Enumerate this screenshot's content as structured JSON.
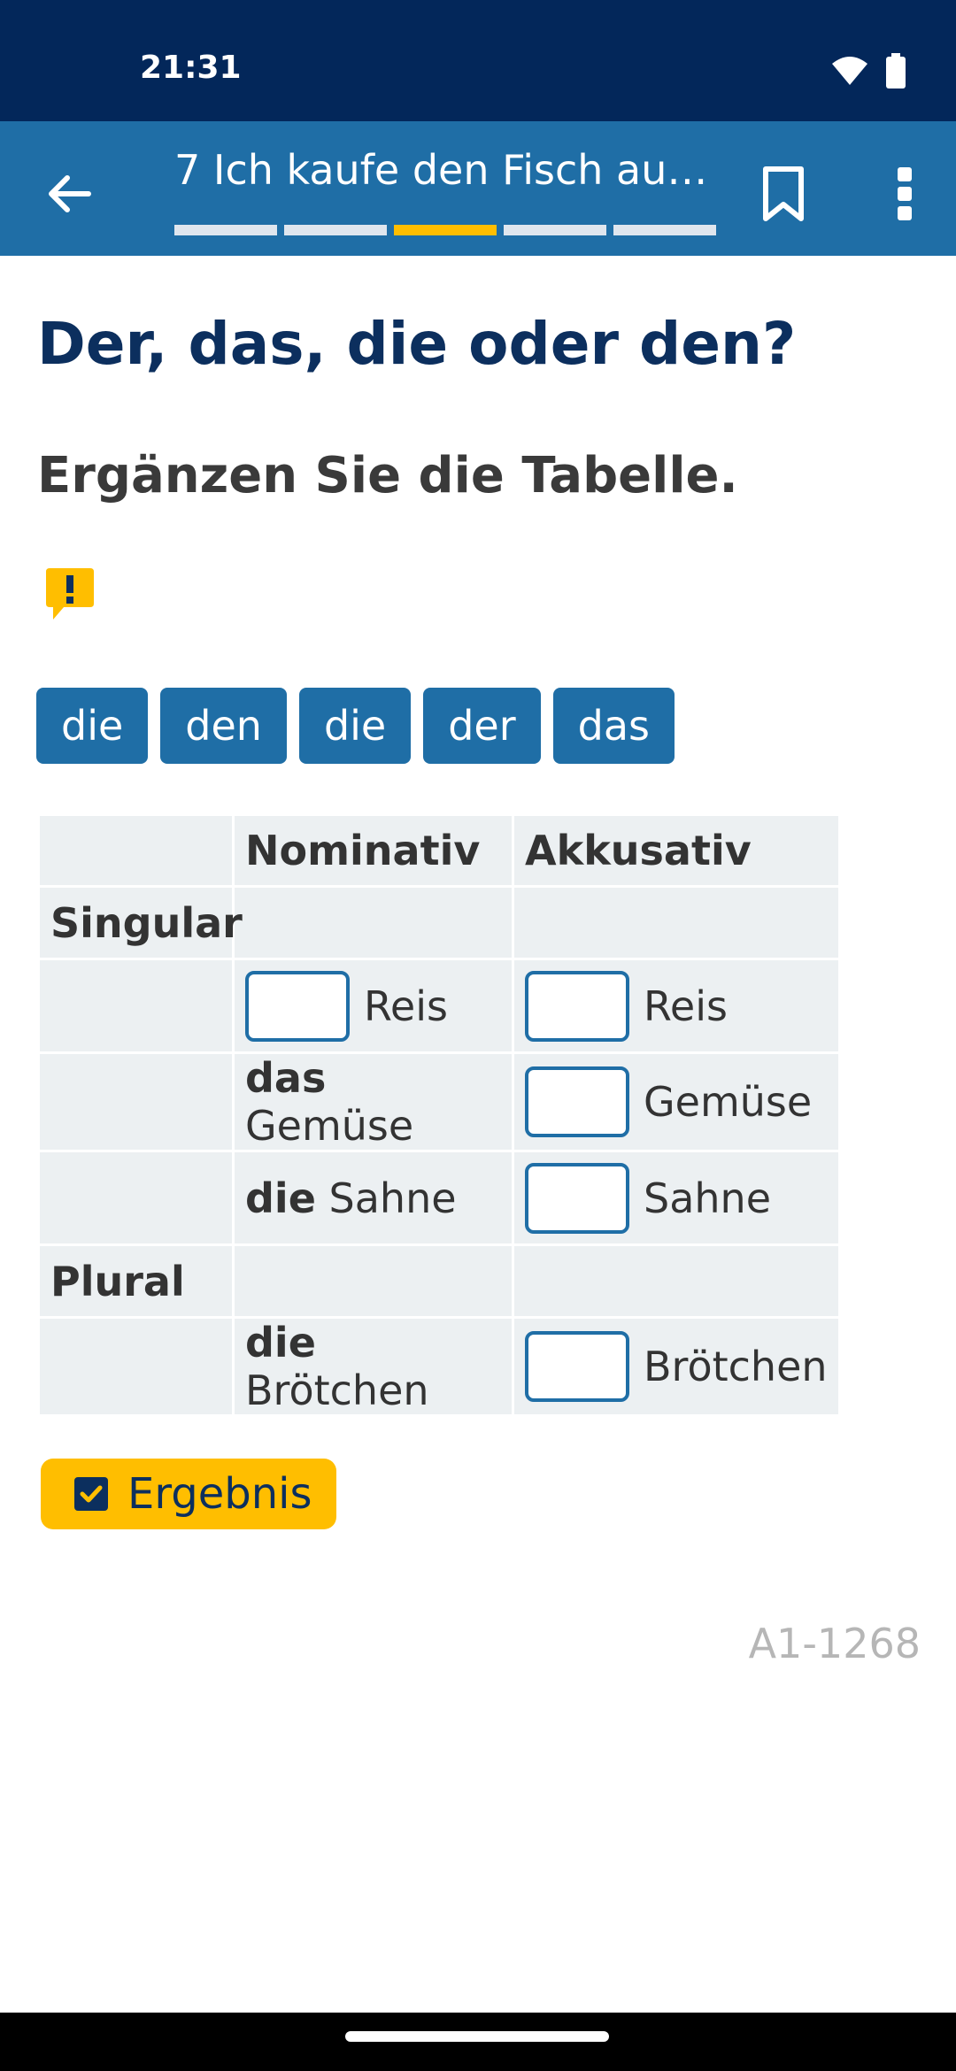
{
  "status": {
    "time": "21:31",
    "icons": [
      "wifi-icon",
      "battery-icon"
    ]
  },
  "appbar": {
    "title": "7 Ich kaufe den Fisch auf ...",
    "progress": {
      "segments": 5,
      "active_index": 2
    },
    "icons": [
      "back-arrow-icon",
      "bookmark-icon",
      "more-vert-icon"
    ]
  },
  "exercise": {
    "title": "Der, das, die oder den?",
    "instruction": "Ergänzen Sie die Tabelle.",
    "hint_icon": "alert-icon",
    "chips": [
      "die",
      "den",
      "die",
      "der",
      "das"
    ]
  },
  "table": {
    "headers": [
      "",
      "Nominativ",
      "Akkusativ"
    ],
    "singular_label": "Singular",
    "plural_label": "Plural",
    "rows": {
      "reis": {
        "nom_article": "",
        "nom_noun": "Reis",
        "akk_noun": "Reis"
      },
      "gemuese": {
        "nom_article": "das",
        "nom_noun": "Gemüse",
        "akk_noun": "Gemüse"
      },
      "sahne": {
        "nom_article": "die",
        "nom_noun": "Sahne",
        "akk_noun": "Sahne"
      },
      "broetchen": {
        "nom_article": "die",
        "nom_noun": "Brötchen",
        "akk_noun": "Brötchen"
      }
    }
  },
  "result_button": {
    "label": "Ergebnis",
    "icon": "checkbox-icon"
  },
  "code": "A1-1268",
  "colors": {
    "status_bg": "#03275a",
    "appbar_bg": "#1f6ea6",
    "accent": "#ffbe00",
    "heading": "#0c2f5e"
  }
}
